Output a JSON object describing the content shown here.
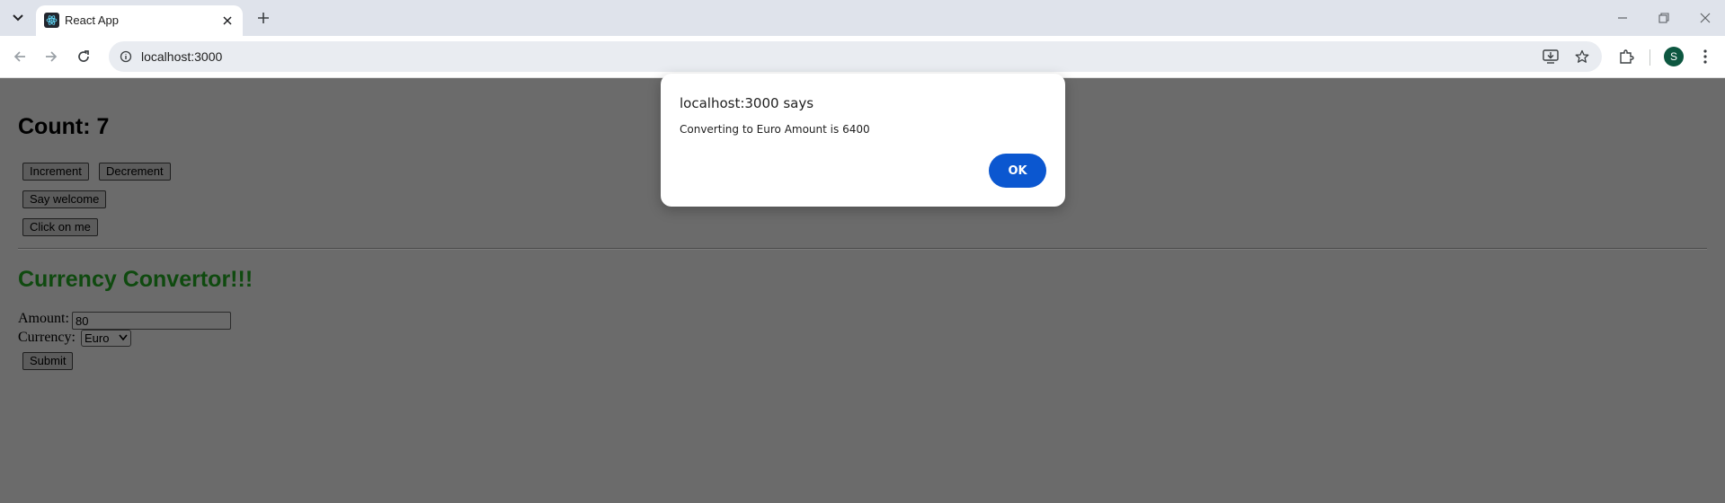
{
  "browser": {
    "tab": {
      "title": "React App",
      "favicon": "react-icon"
    },
    "address": {
      "url": "localhost:3000"
    },
    "profile_initial": "S",
    "colors": {
      "tabstrip": "#dfe3eb",
      "omnibox": "#e9ecf1",
      "avatar": "#0d5740"
    }
  },
  "page": {
    "count_heading": "Count: 7",
    "buttons": {
      "increment": "Increment",
      "decrement": "Decrement",
      "say_welcome": "Say welcome",
      "click_on_me": "Click on me",
      "submit": "Submit"
    },
    "currency": {
      "heading": "Currency Convertor!!!",
      "heading_color": "#0f4a0f",
      "amount_label": "Amount:",
      "amount_value": "80",
      "currency_label": "Currency:",
      "currency_selected": "Euro"
    }
  },
  "dialog": {
    "title": "localhost:3000 says",
    "message": "Converting to Euro Amount is 6400",
    "ok_label": "OK",
    "ok_color": "#0b57d0"
  }
}
